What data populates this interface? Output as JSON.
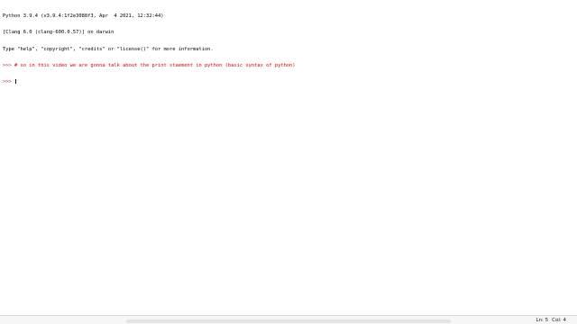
{
  "shell": {
    "lines": [
      "Python 3.9.4 (v3.9.4:1f2e3088f3, Apr  4 2021, 12:32:44)",
      "[Clang 6.0 (clang-600.0.57)] on darwin",
      "Type \"help\", \"copyright\", \"credits\" or \"license()\" for more information."
    ],
    "prompt": ">>> ",
    "comment": "# so in this video we are gonna talk about the print staement in python (basic syntax of python)",
    "current_prompt": ">>> "
  },
  "statusbar": {
    "line": "Ln: 5",
    "col": "Col: 4"
  },
  "colors": {
    "comment": "#dd0000",
    "prompt": "#9a2a2a"
  },
  "icons": {
    "pointer": "mouse-pointer-icon"
  }
}
